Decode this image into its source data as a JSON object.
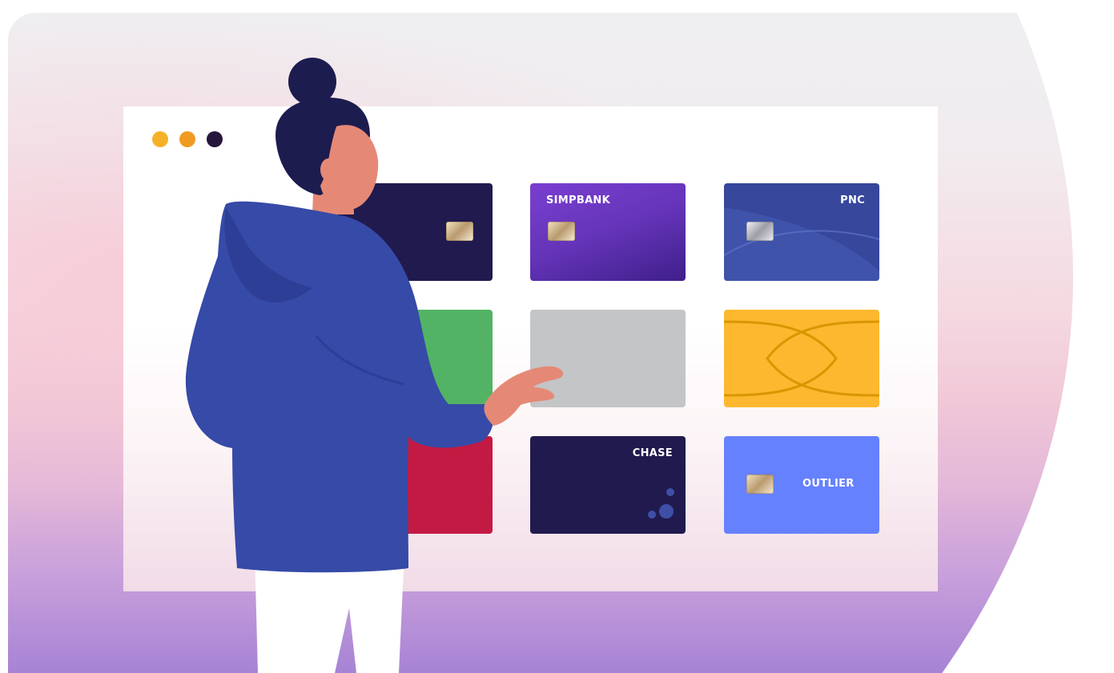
{
  "window": {
    "dots": [
      {
        "color": "#f5b229"
      },
      {
        "color": "#ef9b22"
      },
      {
        "color": "#26163d"
      }
    ]
  },
  "cards": [
    {
      "label": "",
      "color": "#201a4e",
      "chip": "gold"
    },
    {
      "label": "SIMPBANK",
      "color": "#6434b8",
      "chip": "gold"
    },
    {
      "label": "PNC",
      "color": "#36479c",
      "chip": "silver"
    },
    {
      "label": "",
      "color": "#52b365",
      "chip": ""
    },
    {
      "label": "",
      "color": "#c3c5c7",
      "chip": ""
    },
    {
      "label": "",
      "color": "#fdb830",
      "chip": ""
    },
    {
      "label": "",
      "color": "#c31a43",
      "chip": ""
    },
    {
      "label": "CHASE",
      "color": "#201a4e",
      "chip": ""
    },
    {
      "label": "OUTLIER",
      "color": "#6681fd",
      "chip": "gold"
    }
  ],
  "person": {
    "hair_color": "#1d1c4f",
    "skin_color": "#e58976",
    "hoodie_color": "#364aa7",
    "pants_color": "#ffffff"
  }
}
